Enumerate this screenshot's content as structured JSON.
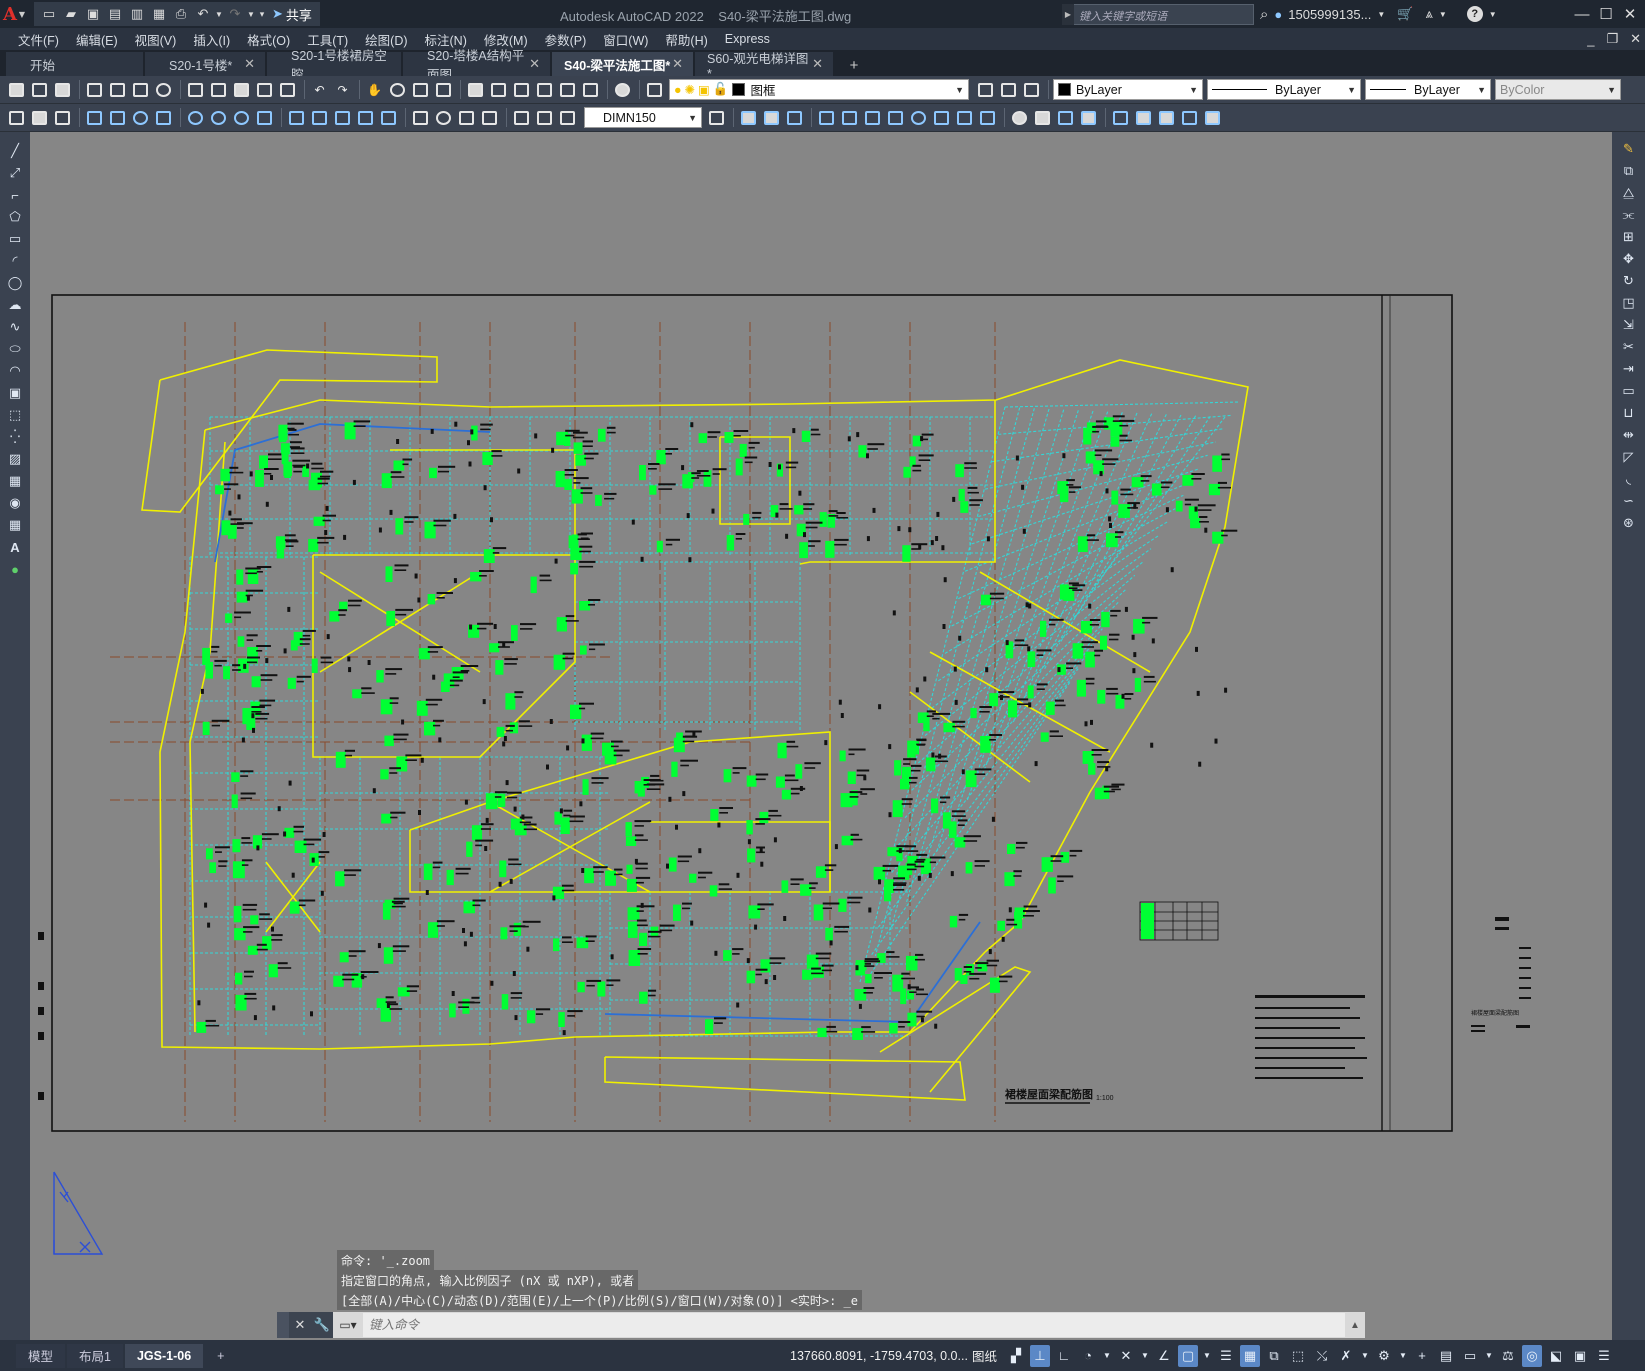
{
  "titlebar": {
    "logo": "A",
    "share_label": "共享",
    "app_name": "Autodesk AutoCAD 2022",
    "file_name": "S40-梁平法施工图.dwg",
    "search_placeholder": "键入关键字或短语",
    "user": "1505999135...",
    "help": "?"
  },
  "menu": [
    "文件(F)",
    "编辑(E)",
    "视图(V)",
    "插入(I)",
    "格式(O)",
    "工具(T)",
    "绘图(D)",
    "标注(N)",
    "修改(M)",
    "参数(P)",
    "窗口(W)",
    "帮助(H)",
    "Express"
  ],
  "tabs": [
    {
      "label": "开始",
      "closable": false,
      "active": false
    },
    {
      "label": "S20-1号楼*",
      "closable": true,
      "active": false
    },
    {
      "label": "S20-1号楼裙房空腔",
      "closable": false,
      "active": false
    },
    {
      "label": "S20-塔楼A结构平面图",
      "closable": true,
      "active": false
    },
    {
      "label": "S40-梁平法施工图*",
      "closable": true,
      "active": true
    },
    {
      "label": "S60-观光电梯详图*",
      "closable": true,
      "active": false
    }
  ],
  "new_tab": "+",
  "toolbar1": {
    "layer": "图框",
    "color": "ByLayer",
    "linetype": "ByLayer",
    "lineweight": "ByLayer",
    "plotstyle": "ByColor"
  },
  "toolbar2": {
    "dimstyle": "DIMN150"
  },
  "drawing": {
    "plan_title": "裙楼屋面梁配筋图",
    "plan_scale": "1:100",
    "side_note": "裙楼屋面梁配筋图"
  },
  "command": {
    "history": [
      "命令: '_.zoom",
      "指定窗口的角点, 输入比例因子 (nX 或 nXP), 或者",
      "[全部(A)/中心(C)/动态(D)/范围(E)/上一个(P)/比例(S)/窗口(W)/对象(O)] <实时>: _e"
    ],
    "placeholder": "键入命令"
  },
  "status": {
    "layout_tabs": [
      {
        "label": "模型",
        "active": false
      },
      {
        "label": "布局1",
        "active": false
      },
      {
        "label": "JGS-1-06",
        "active": true
      }
    ],
    "add_layout": "+",
    "coordinates": "137660.8091, -1759.4703, 0.0...",
    "space": "图纸"
  },
  "colors": {
    "canvas_bg": "#868686",
    "beam_yellow": "#f0f000",
    "grid_cyan": "#34d6d6",
    "label_green": "#00ff33",
    "axis_brown": "#8b4a2b",
    "accent_blue": "#2c6fd6"
  }
}
